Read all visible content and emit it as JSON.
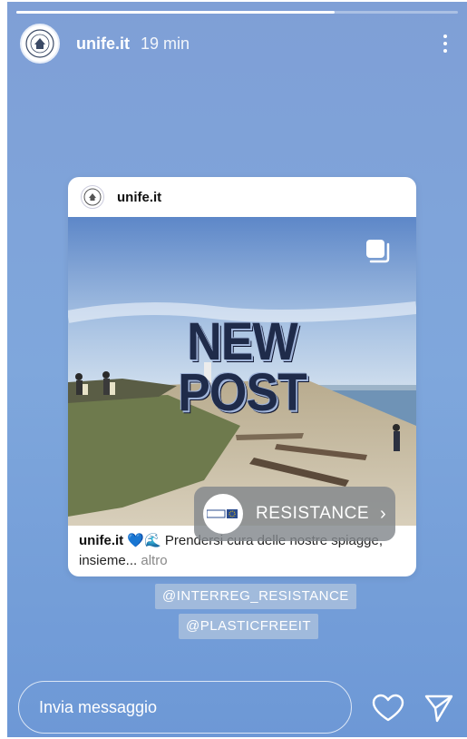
{
  "story": {
    "progress_fraction": 0.72,
    "user": "unife.it",
    "time": "19 min"
  },
  "post": {
    "user": "unife.it",
    "overlay_line1": "NEW",
    "overlay_line2": "POST",
    "caption_user": "unife.it",
    "caption_emoji": "💙🌊",
    "caption_text": " Prendersi cura delle nostre spiagge, insieme...",
    "caption_more": " altro"
  },
  "link_sticker": {
    "label": "RESISTANCE"
  },
  "mentions": [
    "@INTERREG_RESISTANCE",
    "@PLASTICFREEIT"
  ],
  "footer": {
    "reply_placeholder": "Invia messaggio"
  },
  "icons": {
    "more": "more-vertical-icon",
    "carousel": "multiple-photos-icon",
    "heart": "heart-icon",
    "send": "send-icon"
  },
  "colors": {
    "background": "#7fa7dc"
  }
}
